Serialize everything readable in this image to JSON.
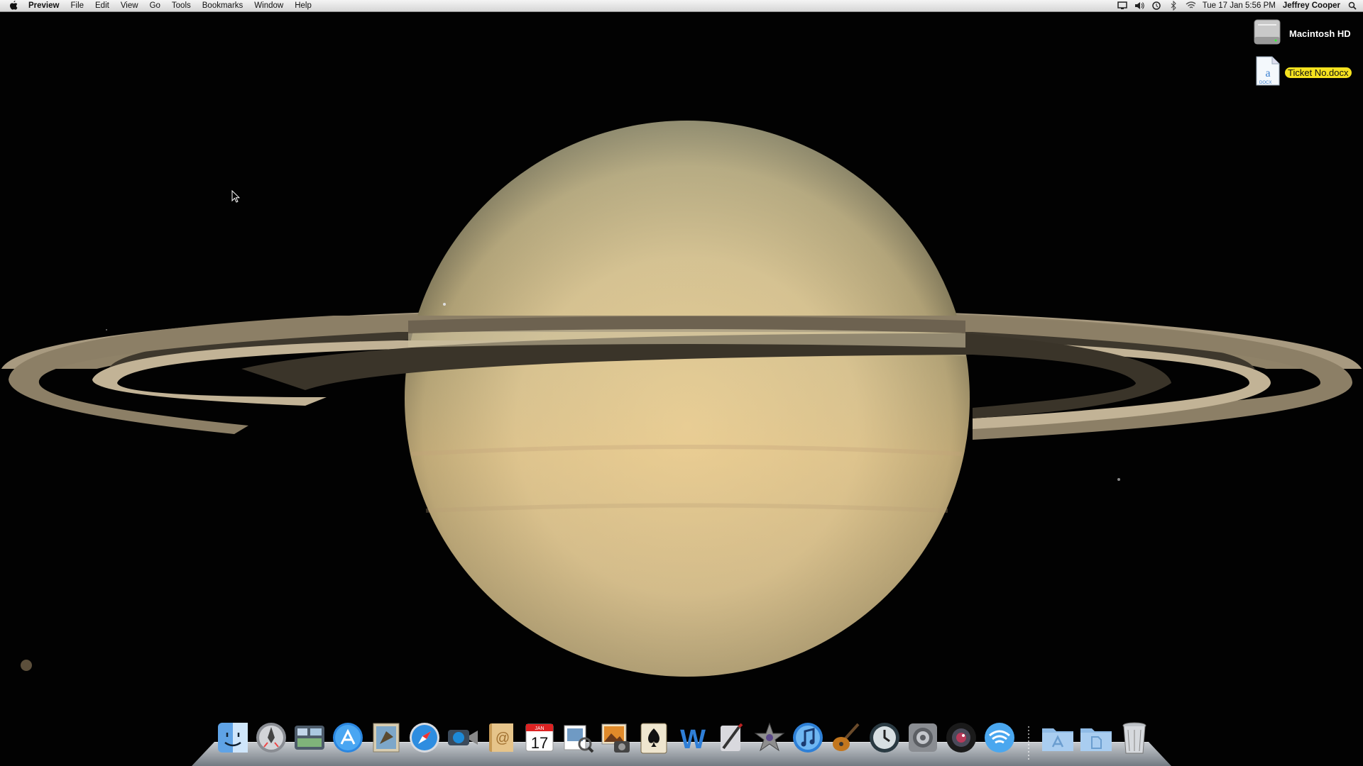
{
  "menubar": {
    "apple_icon": "apple-icon",
    "app_name": "Preview",
    "items": [
      "File",
      "Edit",
      "View",
      "Go",
      "Tools",
      "Bookmarks",
      "Window",
      "Help"
    ],
    "status_icons": [
      "display-icon",
      "volume-icon",
      "time-machine-icon",
      "bluetooth-icon",
      "wifi-icon"
    ],
    "clock": "Tue 17 Jan  5:56 PM",
    "user": "Jeffrey Cooper",
    "spotlight_icon": "spotlight-icon"
  },
  "desktop": {
    "icons": [
      {
        "label": "Macintosh HD",
        "icon": "hard-drive-icon"
      },
      {
        "label": "Ticket No.docx",
        "icon": "docx-file-icon"
      }
    ],
    "wallpaper": "saturn"
  },
  "dock": {
    "apps": [
      "finder-icon",
      "launchpad-icon",
      "mission-control-icon",
      "app-store-icon",
      "mail-icon",
      "safari-icon",
      "facetime-icon",
      "address-book-icon",
      "ical-icon",
      "preview-icon",
      "iphoto-icon",
      "solitaire-icon",
      "word-icon",
      "script-editor-icon",
      "imovie-icon",
      "itunes-icon",
      "garageband-icon",
      "time-machine-icon",
      "system-preferences-icon",
      "photo-booth-icon",
      "airdrop-icon"
    ],
    "ical_date": "17",
    "ical_month": "JAN",
    "stacks": [
      "applications-folder-icon",
      "documents-folder-icon"
    ],
    "trash": "trash-icon"
  },
  "colors": {
    "menubar": "#e6e6e6",
    "selection_label": "#f5e21f",
    "saturn_body": "#d8c394",
    "rings": "#a89a80"
  }
}
